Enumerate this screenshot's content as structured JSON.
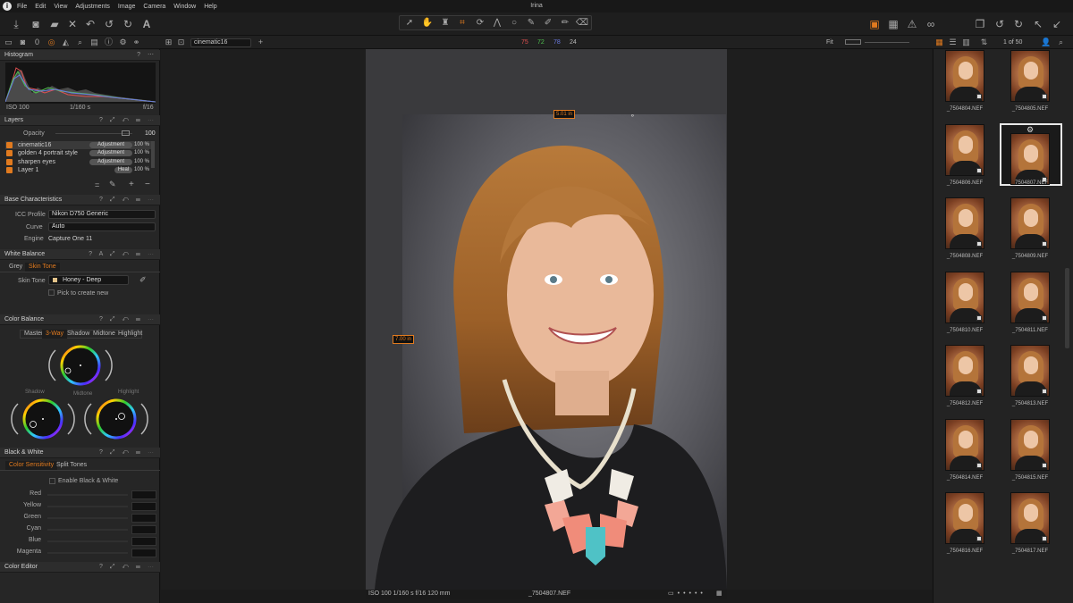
{
  "menubar": {
    "items": [
      "File",
      "Edit",
      "View",
      "Adjustments",
      "Image",
      "Camera",
      "Window",
      "Help"
    ],
    "window_title": "Irina"
  },
  "viewer_toolbar": {
    "variant_name": "cinematic16",
    "rgb": {
      "r": "75",
      "g": "72",
      "b": "78",
      "l": "24"
    },
    "fit_label": "Fit",
    "counter": "1 of 50"
  },
  "histogram": {
    "title": "Histogram",
    "iso": "ISO 100",
    "shutter": "1/160 s",
    "aperture": "f/16"
  },
  "layers": {
    "title": "Layers",
    "opacity_label": "Opacity",
    "opacity_value": "100",
    "rows": [
      {
        "name": "cinematic16",
        "type": "Adjustment",
        "pct": "100 %",
        "selected": true
      },
      {
        "name": "golden 4 portrait style",
        "type": "Adjustment",
        "pct": "100 %"
      },
      {
        "name": "sharpen eyes",
        "type": "Adjustment",
        "pct": "100 %"
      },
      {
        "name": "Layer 1",
        "type": "Heal",
        "pct": "100 %"
      }
    ]
  },
  "base_characteristics": {
    "title": "Base Characteristics",
    "icc_label": "ICC Profile",
    "icc_value": "Nikon D750 Generic",
    "curve_label": "Curve",
    "curve_value": "Auto",
    "engine_label": "Engine",
    "engine_value": "Capture One 11"
  },
  "white_balance": {
    "title": "White Balance",
    "tabs": [
      "Grey",
      "Skin Tone"
    ],
    "skin_tone_label": "Skin Tone",
    "skin_tone_value": "Honey - Deep",
    "pick_label": "Pick to create new"
  },
  "color_balance": {
    "title": "Color Balance",
    "tabs": [
      "Master",
      "3-Way",
      "Shadow",
      "Midtone",
      "Highlight"
    ],
    "wheel_labels": [
      "Shadow",
      "Midtone",
      "Highlight"
    ]
  },
  "black_white": {
    "title": "Black & White",
    "tabs": [
      "Color Sensitivity",
      "Split Tones"
    ],
    "enable_label": "Enable Black & White",
    "channels": [
      "Red",
      "Yellow",
      "Green",
      "Cyan",
      "Blue",
      "Magenta"
    ]
  },
  "color_editor": {
    "title": "Color Editor"
  },
  "crop": {
    "width_label": "5.01 in",
    "height_label": "7.00 in"
  },
  "status_bar": {
    "exif": "ISO 100 1/160 s f/16 120 mm",
    "filename": "_7504807.NEF"
  },
  "thumbnails": [
    "_7504804.NEF",
    "_7504805.NEF",
    "_7504806.NEF",
    "_7504807.NEF",
    "_7504808.NEF",
    "_7504809.NEF",
    "_7504810.NEF",
    "_7504811.NEF",
    "_7504812.NEF",
    "_7504813.NEF",
    "_7504814.NEF",
    "_7504815.NEF",
    "_7504816.NEF",
    "_7504817.NEF"
  ],
  "colors": {
    "accent": "#e07a1f",
    "panel": "#262626",
    "background": "#1b1b1b"
  }
}
